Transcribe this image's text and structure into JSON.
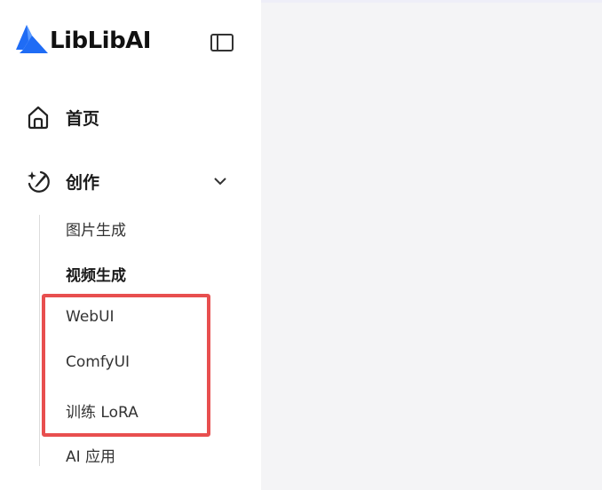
{
  "app": {
    "brand_name": "LibLibAI",
    "brand_color": "#1f6cf5"
  },
  "icons": {
    "logo": "liblib-logo-icon",
    "collapse": "sidebar-collapse-icon",
    "home": "home-icon",
    "create": "sparkle-brush-icon",
    "chevron": "chevron-down-icon"
  },
  "nav": {
    "home_label": "首页",
    "create_label": "创作",
    "create_expanded": true
  },
  "submenu": [
    {
      "label": "图片生成",
      "active": false
    },
    {
      "label": "视频生成",
      "active": true
    },
    {
      "label": "WebUI",
      "active": false
    },
    {
      "label": "ComfyUI",
      "active": false
    },
    {
      "label": "训练 LoRA",
      "active": false
    },
    {
      "label": "AI 应用",
      "active": false
    }
  ],
  "highlight_color": "#e84f4f"
}
